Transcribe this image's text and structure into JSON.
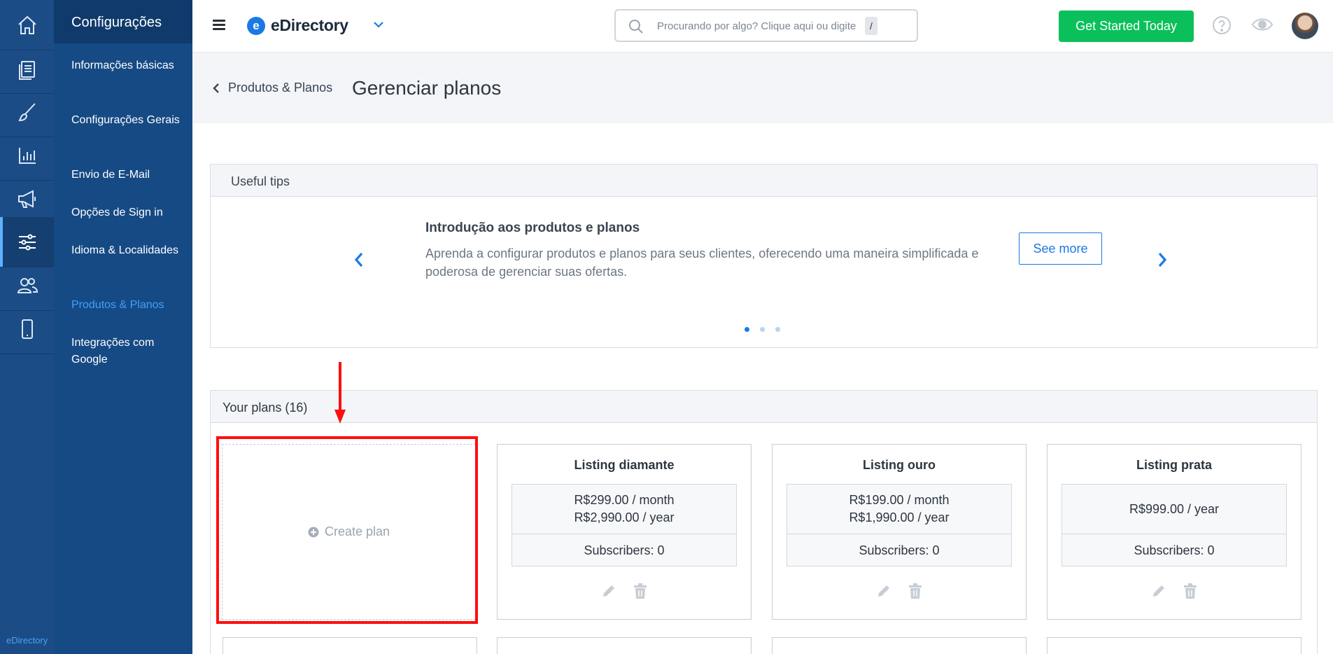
{
  "rail": {
    "footer_text": "eDirectory",
    "items": [
      {
        "icon": "home-icon"
      },
      {
        "icon": "content-icon"
      },
      {
        "icon": "design-brush-icon"
      },
      {
        "icon": "reports-chart-icon"
      },
      {
        "icon": "promote-megaphone-icon"
      },
      {
        "icon": "settings-sliders-icon",
        "active": true
      },
      {
        "icon": "users-icon"
      },
      {
        "icon": "mobile-icon"
      }
    ]
  },
  "sidebar": {
    "title": "Configurações",
    "items": [
      {
        "label": "Informações básicas"
      },
      {
        "label": "Configurações Gerais"
      },
      {
        "label": "Envio de E-Mail"
      },
      {
        "label": "Opções de Sign in"
      },
      {
        "label": "Idioma & Localidades"
      },
      {
        "label": "Produtos & Planos",
        "active": true
      },
      {
        "label": "Integrações com Google"
      }
    ]
  },
  "topbar": {
    "brand": "eDirectory",
    "brand_mark": "e",
    "search_placeholder": "Procurando por algo? Clique aqui ou digite",
    "search_shortcut": "/",
    "cta_label": "Get Started Today"
  },
  "page": {
    "back_label": "Produtos & Planos",
    "title": "Gerenciar planos"
  },
  "tips": {
    "header": "Useful tips",
    "title": "Introdução aos produtos e planos",
    "body": "Aprenda a configurar produtos e planos para seus clientes, oferecendo uma maneira simplificada e poderosa de gerenciar suas ofertas.",
    "button": "See more",
    "slide_count": 3,
    "active_slide": 1
  },
  "plans": {
    "header": "Your plans (16)",
    "create_label": "Create plan",
    "items": [
      {
        "name": "Listing diamante",
        "prices": [
          "R$299.00 / month",
          "R$2,990.00 / year"
        ],
        "subscribers": "Subscribers: 0"
      },
      {
        "name": "Listing ouro",
        "prices": [
          "R$199.00 / month",
          "R$1,990.00 / year"
        ],
        "subscribers": "Subscribers: 0"
      },
      {
        "name": "Listing prata",
        "prices": [
          "R$999.00 / year"
        ],
        "subscribers": "Subscribers: 0"
      }
    ]
  },
  "colors": {
    "rail": "#1b4c85",
    "sidebar": "#164a84",
    "accent": "#1a7ae4",
    "cta": "#0bc05b",
    "highlight": "#ff0e0e"
  }
}
